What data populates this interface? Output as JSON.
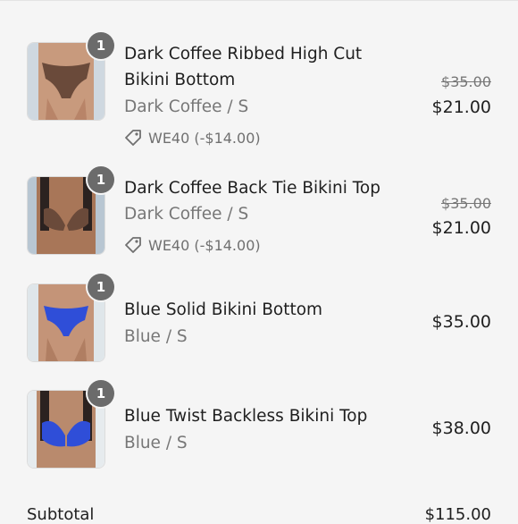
{
  "cart": {
    "items": [
      {
        "quantity": "1",
        "title": "Dark Coffee Ribbed High Cut Bikini Bottom",
        "variant": "Dark Coffee / S",
        "discount": "WE40 (-$14.00)",
        "original_price": "$35.00",
        "price": "$21.00",
        "image_icon": "bikini-bottom-brown"
      },
      {
        "quantity": "1",
        "title": "Dark Coffee Back Tie Bikini Top",
        "variant": "Dark Coffee / S",
        "discount": "WE40 (-$14.00)",
        "original_price": "$35.00",
        "price": "$21.00",
        "image_icon": "bikini-top-brown"
      },
      {
        "quantity": "1",
        "title": "Blue Solid Bikini Bottom",
        "variant": "Blue / S",
        "price": "$35.00",
        "image_icon": "bikini-bottom-blue"
      },
      {
        "quantity": "1",
        "title": "Blue Twist Backless Bikini Top",
        "variant": "Blue / S",
        "price": "$38.00",
        "image_icon": "bikini-top-blue"
      }
    ],
    "subtotal_label": "Subtotal",
    "subtotal_value": "$115.00"
  },
  "colors": {
    "background": "#f5f5f5",
    "badge": "#6b6b6b",
    "brown_swim": "#6a4a3a",
    "blue_swim": "#2f4ed8"
  }
}
